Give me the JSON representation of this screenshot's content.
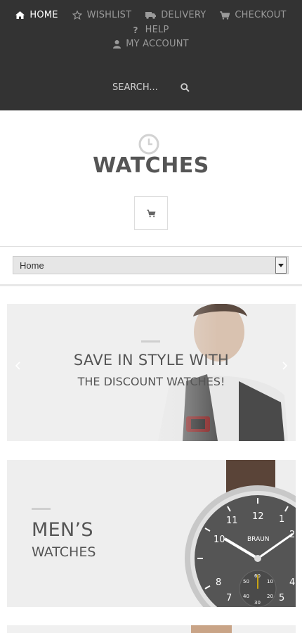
{
  "nav": {
    "row1": [
      {
        "label": "HOME",
        "icon": "home-icon",
        "active": true
      },
      {
        "label": "WISHLIST",
        "icon": "star-icon"
      },
      {
        "label": "DELIVERY",
        "icon": "truck-icon"
      },
      {
        "label": "CHECKOUT",
        "icon": "cart-icon"
      }
    ],
    "help": {
      "label": "HELP",
      "icon": "question-icon"
    },
    "account": {
      "label": "MY ACCOUNT",
      "icon": "user-icon"
    }
  },
  "search": {
    "placeholder": "SEARCH...",
    "icon": "search-icon"
  },
  "header": {
    "title": "WATCHES",
    "logo_icon": "clock-icon",
    "cart_icon": "cart-icon"
  },
  "category_select": {
    "selected": "Home"
  },
  "banners": [
    {
      "title": "SAVE IN STYLE WITH",
      "subtitle": "THE DISCOUNT WATCHES!"
    },
    {
      "title": "MEN’S",
      "subtitle": "WATCHES",
      "watch_brand": "BRAUN",
      "dial_numbers": [
        "12",
        "1",
        "2",
        "4",
        "5",
        "7",
        "8",
        "10",
        "11"
      ],
      "subdial_numbers": [
        "60",
        "10",
        "20",
        "50",
        "40",
        "30"
      ]
    }
  ],
  "colors": {
    "header_bg": "#333333",
    "nav_inactive": "#9a9a9a",
    "nav_active": "#ffffff",
    "title": "#555555",
    "banner_bg": "#eeeeee"
  }
}
